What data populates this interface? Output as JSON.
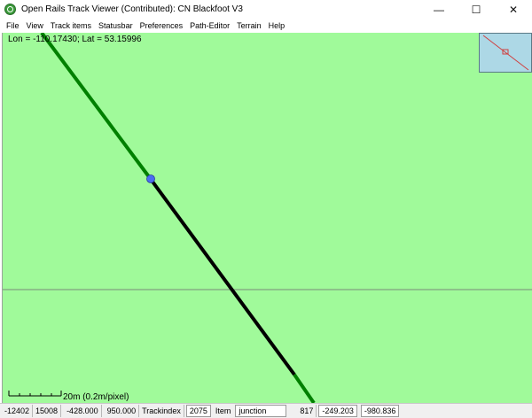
{
  "window": {
    "title": "Open Rails Track Viewer (Contributed): CN Blackfoot V3",
    "minimize_glyph": "—",
    "maximize_glyph": "☐",
    "close_glyph": "✕"
  },
  "menu": {
    "items": [
      "File",
      "View",
      "Track items",
      "Statusbar",
      "Preferences",
      "Path-Editor",
      "Terrain",
      "Help"
    ]
  },
  "canvas": {
    "lonlat": "Lon = -110.17430; Lat = 53.15996",
    "scale_label": "20m (0.2m/pixel)",
    "colors": {
      "background": "#a0fa9a",
      "track_green": "#008000",
      "track_black": "#000000",
      "node": "#4a6cf0",
      "overview_bg": "#add8e6",
      "overview_line": "#d04040"
    }
  },
  "statusbar": {
    "tile_x": "-12402",
    "tile_z": "15008",
    "x": "-428.000",
    "z": "950.000",
    "trackindex_label": "Trackindex",
    "trackindex_value": "2075",
    "item_label": "Item",
    "item_value": "junction",
    "item_index": "817",
    "coord_a": "-249.203",
    "coord_b": "-980.836"
  }
}
